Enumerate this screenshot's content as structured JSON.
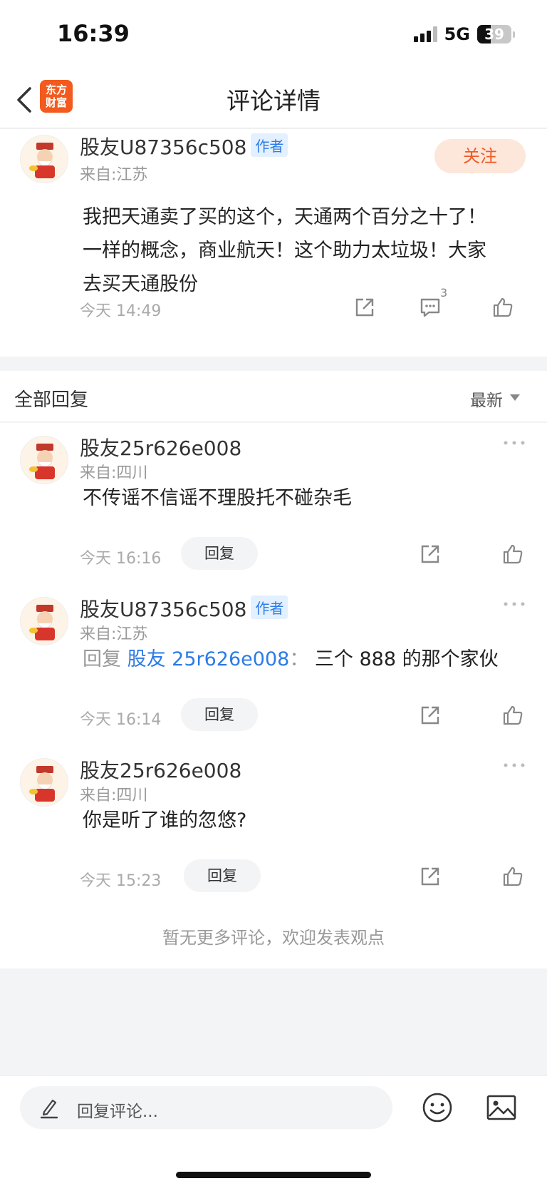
{
  "status": {
    "time": "16:39",
    "network": "5G",
    "battery": "39"
  },
  "nav": {
    "title": "评论详情",
    "logo_text": "东方财富"
  },
  "post": {
    "username": "股友U87356c508",
    "author_tag": "作者",
    "location": "来自:江苏",
    "follow_label": "关注",
    "lines": [
      "我把天通卖了买的这个，天通两个百分之十了！",
      "一样的概念，商业航天！这个助力太垃圾！大家",
      "去买天通股份"
    ],
    "time": "今天 14:49",
    "comment_count": "3"
  },
  "replies_header": {
    "title": "全部回复",
    "sort": "最新"
  },
  "replies": [
    {
      "username": "股友25r626e008",
      "location": "来自:四川",
      "text": "不传谣不信谣不理股托不碰杂毛",
      "time": "今天 16:16",
      "reply_label": "回复"
    },
    {
      "username": "股友U87356c508",
      "author_tag": "作者",
      "location": "来自:江苏",
      "reply_prefix": "回复",
      "mention": "股友 25r626e008",
      "separator": "：",
      "text": "三个 888 的那个家伙",
      "time": "今天 16:14",
      "reply_label": "回复"
    },
    {
      "username": "股友25r626e008",
      "location": "来自:四川",
      "text": "你是听了谁的忽悠?",
      "time": "今天 15:23",
      "reply_label": "回复"
    }
  ],
  "empty_tip": "暂无更多评论，欢迎发表观点",
  "bottom": {
    "input_placeholder": "回复评论..."
  }
}
